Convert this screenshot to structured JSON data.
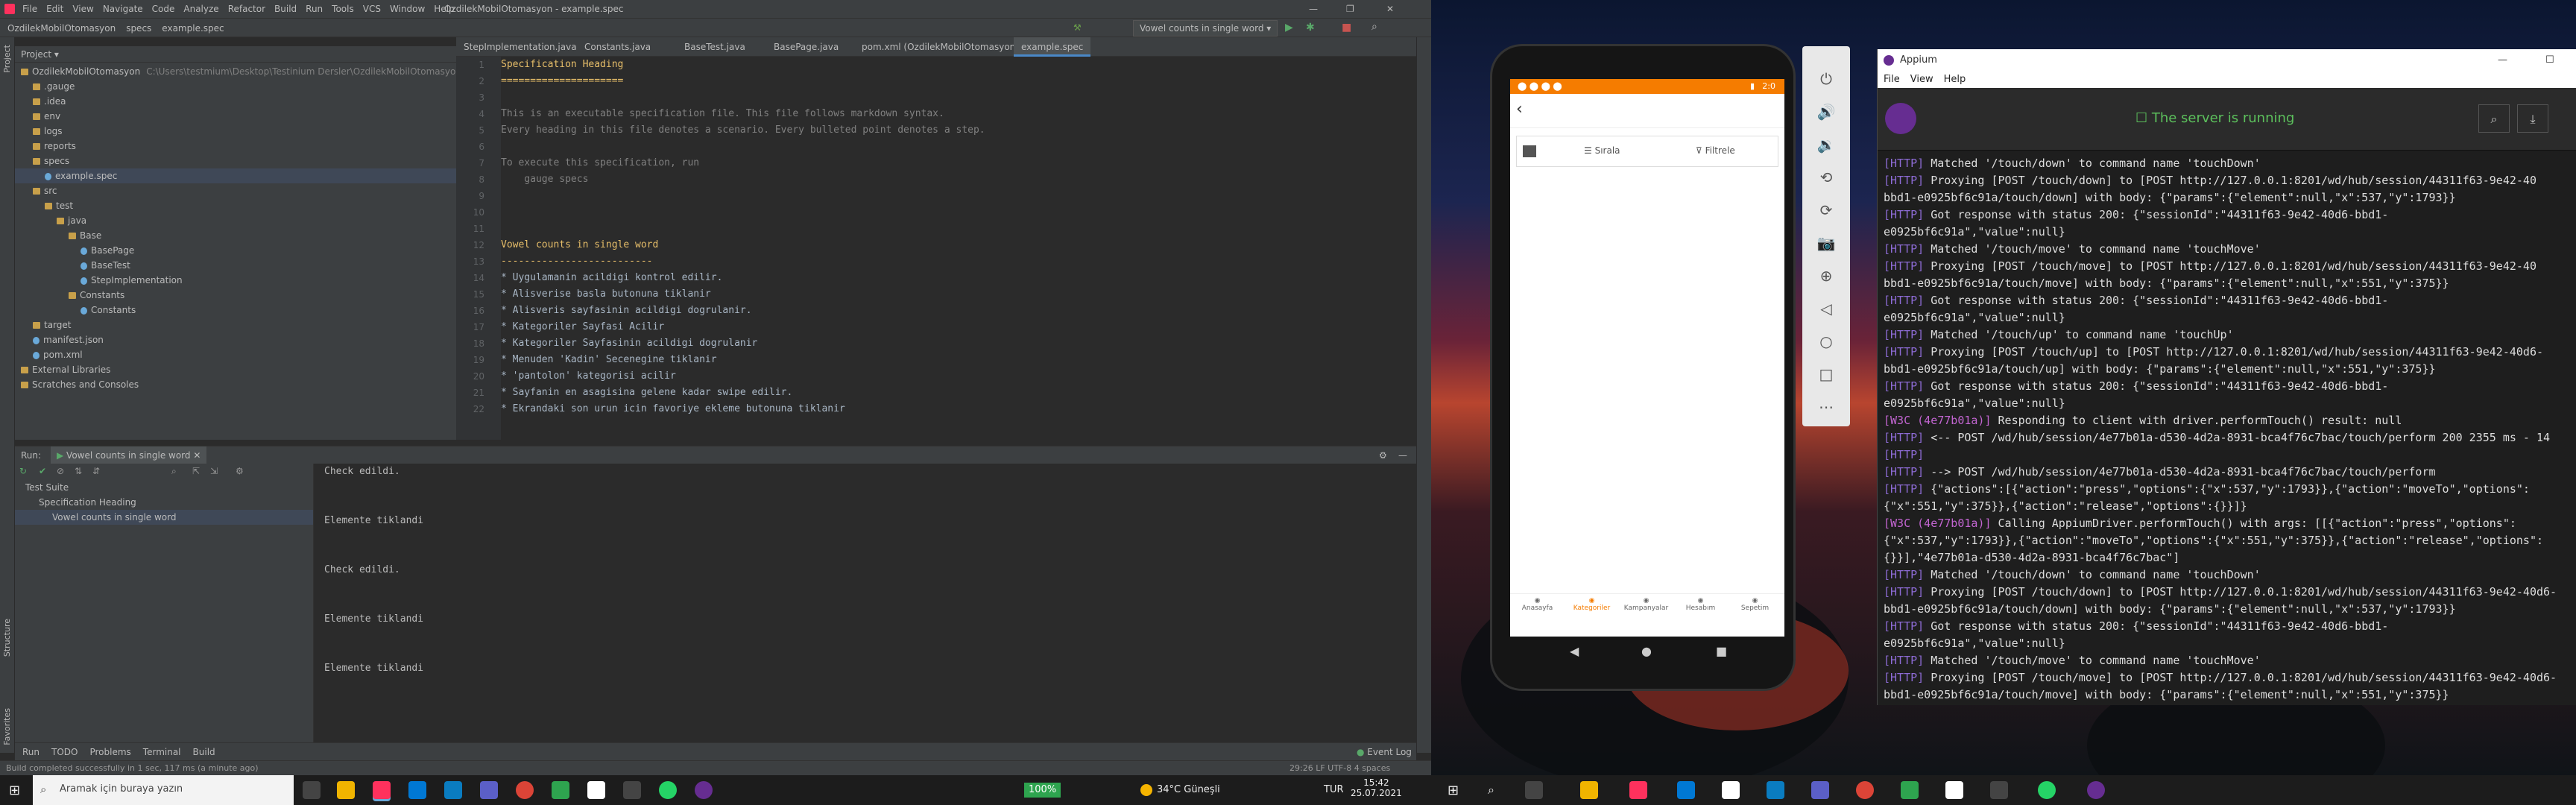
{
  "ide": {
    "title": "OzdilekMobilOtomasyon - example.spec",
    "menu": [
      "File",
      "Edit",
      "View",
      "Navigate",
      "Code",
      "Analyze",
      "Refactor",
      "Build",
      "Run",
      "Tools",
      "VCS",
      "Window",
      "Help"
    ],
    "breadcrumb": [
      "OzdilekMobilOtomasyon",
      "specs",
      "example.spec"
    ],
    "run_config": "Vowel counts in single word",
    "project_panel_label": "Project",
    "project_tree": [
      {
        "label": "OzdilekMobilOtomasyon",
        "path": "C:\\Users\\testmium\\Desktop\\Testinium Dersler\\OzdilekMobilOtomasyon\\Oz",
        "indent": 0,
        "type": "folder"
      },
      {
        "label": ".gauge",
        "indent": 1,
        "type": "folder"
      },
      {
        "label": ".idea",
        "indent": 1,
        "type": "folder"
      },
      {
        "label": "env",
        "indent": 1,
        "type": "folder"
      },
      {
        "label": "logs",
        "indent": 1,
        "type": "folder"
      },
      {
        "label": "reports",
        "indent": 1,
        "type": "folder"
      },
      {
        "label": "specs",
        "indent": 1,
        "type": "folder"
      },
      {
        "label": "example.spec",
        "indent": 2,
        "type": "file",
        "selected": true
      },
      {
        "label": "src",
        "indent": 1,
        "type": "folder"
      },
      {
        "label": "test",
        "indent": 2,
        "type": "folder"
      },
      {
        "label": "java",
        "indent": 3,
        "type": "folder"
      },
      {
        "label": "Base",
        "indent": 4,
        "type": "folder"
      },
      {
        "label": "BasePage",
        "indent": 5,
        "type": "file"
      },
      {
        "label": "BaseTest",
        "indent": 5,
        "type": "file"
      },
      {
        "label": "StepImplementation",
        "indent": 5,
        "type": "file"
      },
      {
        "label": "Constants",
        "indent": 4,
        "type": "folder"
      },
      {
        "label": "Constants",
        "indent": 5,
        "type": "file"
      },
      {
        "label": "target",
        "indent": 1,
        "type": "folder"
      },
      {
        "label": "manifest.json",
        "indent": 1,
        "type": "file"
      },
      {
        "label": "pom.xml",
        "indent": 1,
        "type": "file"
      },
      {
        "label": "External Libraries",
        "indent": 0,
        "type": "folder"
      },
      {
        "label": "Scratches and Consoles",
        "indent": 0,
        "type": "folder"
      }
    ],
    "tabs": [
      "StepImplementation.java",
      "Constants.java",
      "BaseTest.java",
      "BasePage.java",
      "pom.xml (OzdilekMobilOtomasyon)",
      "example.spec"
    ],
    "active_tab": 5,
    "editor_lines": [
      {
        "n": "1",
        "text": "Specification Heading",
        "kind": "head"
      },
      {
        "n": "2",
        "text": "=====================",
        "kind": "head"
      },
      {
        "n": "3",
        "text": "",
        "kind": "note"
      },
      {
        "n": "4",
        "text": "This is an executable specification file. This file follows markdown syntax.",
        "kind": "note"
      },
      {
        "n": "5",
        "text": "Every heading in this file denotes a scenario. Every bulleted point denotes a step.",
        "kind": "note"
      },
      {
        "n": "6",
        "text": "",
        "kind": "note"
      },
      {
        "n": "7",
        "text": "To execute this specification, run",
        "kind": "note"
      },
      {
        "n": "8",
        "text": "    gauge specs",
        "kind": "note"
      },
      {
        "n": "9",
        "text": "",
        "kind": "note"
      },
      {
        "n": "10",
        "text": "",
        "kind": "note"
      },
      {
        "n": "11",
        "text": "",
        "kind": "note"
      },
      {
        "n": "12",
        "text": "Vowel counts in single word",
        "kind": "head"
      },
      {
        "n": "13",
        "text": "--------------------------",
        "kind": "head"
      },
      {
        "n": "14",
        "text": "* Uygulamanin acildigi kontrol edilir.",
        "kind": "step"
      },
      {
        "n": "15",
        "text": "* Alisverise basla butonuna tiklanir",
        "kind": "step"
      },
      {
        "n": "16",
        "text": "* Alisveris sayfasinin acildigi dogrulanir.",
        "kind": "step"
      },
      {
        "n": "17",
        "text": "* Kategoriler Sayfasi Acilir",
        "kind": "step"
      },
      {
        "n": "18",
        "text": "* Kategoriler Sayfasinin acildigi dogrulanir",
        "kind": "step"
      },
      {
        "n": "19",
        "text": "* Menuden 'Kadin' Secenegine tiklanir",
        "kind": "step"
      },
      {
        "n": "20",
        "text": "* 'pantolon' kategorisi acilir",
        "kind": "step"
      },
      {
        "n": "21",
        "text": "* Sayfanin en asagisina gelene kadar swipe edilir.",
        "kind": "step"
      },
      {
        "n": "22",
        "text": "* Ekrandaki son urun icin favoriye ekleme butonuna tiklanir",
        "kind": "step"
      }
    ],
    "run_tab_label": "Run:",
    "run_tab_config": "Vowel counts in single word",
    "test_tree": [
      {
        "label": "Test Suite",
        "indent": 0
      },
      {
        "label": "Specification Heading",
        "indent": 1
      },
      {
        "label": "Vowel counts in single word",
        "indent": 2,
        "selected": true
      }
    ],
    "console_lines": [
      "Check edildi.",
      "Elemente tiklandi",
      "Check edildi.",
      "Elemente tiklandi",
      "Elemente tiklandi"
    ],
    "bottom_tabs": [
      "Run",
      "TODO",
      "Problems",
      "Terminal",
      "Build"
    ],
    "event_log": "Event Log",
    "status_left": "Build completed successfully in 1 sec, 117 ms (a minute ago)",
    "status_right": "29:26   LF   UTF-8   4 spaces",
    "sidebar_left": [
      "Project",
      "Structure",
      "Favorites"
    ]
  },
  "phone": {
    "status_time": "2:0",
    "tabs": [
      "Sırala",
      "Filtrele"
    ],
    "bottom_nav": [
      "Anasayfa",
      "Kategoriler",
      "Kampanyalar",
      "Hesabım",
      "Sepetim"
    ],
    "active_nav": 1,
    "accent": "#f57c00"
  },
  "emulator_tools": [
    "power-icon",
    "volume-up-icon",
    "volume-down-icon",
    "rotate-left-icon",
    "rotate-right-icon",
    "camera-icon",
    "zoom-icon",
    "back-icon",
    "home-icon",
    "overview-icon",
    "more-icon"
  ],
  "appium": {
    "title": "Appium",
    "menu": [
      "File",
      "View",
      "Help"
    ],
    "status": "The server is running",
    "log": [
      {
        "tag": "[HTTP]",
        "text": "Matched '/touch/down' to command name 'touchDown'",
        "hl": false
      },
      {
        "tag": "[HTTP]",
        "text": "Proxying [POST /touch/down] to [POST http://127.0.0.1:8201/wd/hub/session/44311f63-9e42-40",
        "hl": false
      },
      {
        "tag": "",
        "text": "bbd1-e0925bf6c91a/touch/down] with body: {\"params\":{\"element\":null,\"x\":537,\"y\":1793}}",
        "hl": false
      },
      {
        "tag": "[HTTP]",
        "text": "Got response with status 200: {\"sessionId\":\"44311f63-9e42-40d6-bbd1-",
        "hl": false
      },
      {
        "tag": "",
        "text": "e0925bf6c91a\",\"value\":null}",
        "hl": false
      },
      {
        "tag": "[HTTP]",
        "text": "Matched '/touch/move' to command name 'touchMove'",
        "hl": false
      },
      {
        "tag": "[HTTP]",
        "text": "Proxying [POST /touch/move] to [POST http://127.0.0.1:8201/wd/hub/session/44311f63-9e42-40",
        "hl": false
      },
      {
        "tag": "",
        "text": "bbd1-e0925bf6c91a/touch/move] with body: {\"params\":{\"element\":null,\"x\":551,\"y\":375}}",
        "hl": false
      },
      {
        "tag": "[HTTP]",
        "text": "Got response with status 200: {\"sessionId\":\"44311f63-9e42-40d6-bbd1-",
        "hl": false
      },
      {
        "tag": "",
        "text": "e0925bf6c91a\",\"value\":null}",
        "hl": false
      },
      {
        "tag": "[HTTP]",
        "text": "Matched '/touch/up' to command name 'touchUp'",
        "hl": false
      },
      {
        "tag": "[HTTP]",
        "text": "Proxying [POST /touch/up] to [POST http://127.0.0.1:8201/wd/hub/session/44311f63-9e42-40d6-",
        "hl": false
      },
      {
        "tag": "",
        "text": "bbd1-e0925bf6c91a/touch/up] with body: {\"params\":{\"element\":null,\"x\":551,\"y\":375}}",
        "hl": false
      },
      {
        "tag": "[HTTP]",
        "text": "Got response with status 200: {\"sessionId\":\"44311f63-9e42-40d6-bbd1-",
        "hl": false
      },
      {
        "tag": "",
        "text": "e0925bf6c91a\",\"value\":null}",
        "hl": false
      },
      {
        "tag": "[W3C (4e77b01a)]",
        "text": "Responding to client with driver.performTouch() result: null",
        "hl": true
      },
      {
        "tag": "[HTTP]",
        "text": "<-- POST /wd/hub/session/4e77b01a-d530-4d2a-8931-bca4f76c7bac/touch/perform 200 2355 ms - 14",
        "hl": false
      },
      {
        "tag": "[HTTP]",
        "text": "",
        "hl": false
      },
      {
        "tag": "[HTTP]",
        "text": "--> POST /wd/hub/session/4e77b01a-d530-4d2a-8931-bca4f76c7bac/touch/perform",
        "hl": false
      },
      {
        "tag": "[HTTP]",
        "text": "{\"actions\":[{\"action\":\"press\",\"options\":{\"x\":537,\"y\":1793}},{\"action\":\"moveTo\",\"options\":",
        "hl": false
      },
      {
        "tag": "",
        "text": "{\"x\":551,\"y\":375}},{\"action\":\"release\",\"options\":{}}]}",
        "hl": false
      },
      {
        "tag": "[W3C (4e77b01a)]",
        "text": "Calling AppiumDriver.performTouch() with args: [[{\"action\":\"press\",\"options\":",
        "hl": true
      },
      {
        "tag": "",
        "text": "{\"x\":537,\"y\":1793}},{\"action\":\"moveTo\",\"options\":{\"x\":551,\"y\":375}},{\"action\":\"release\",\"options\":",
        "hl": false
      },
      {
        "tag": "",
        "text": "{}}],\"4e77b01a-d530-4d2a-8931-bca4f76c7bac\"]",
        "hl": false
      },
      {
        "tag": "[HTTP]",
        "text": "Matched '/touch/down' to command name 'touchDown'",
        "hl": false
      },
      {
        "tag": "[HTTP]",
        "text": "Proxying [POST /touch/down] to [POST http://127.0.0.1:8201/wd/hub/session/44311f63-9e42-40d6-",
        "hl": false
      },
      {
        "tag": "",
        "text": "bbd1-e0925bf6c91a/touch/down] with body: {\"params\":{\"element\":null,\"x\":537,\"y\":1793}}",
        "hl": false
      },
      {
        "tag": "[HTTP]",
        "text": "Got response with status 200: {\"sessionId\":\"44311f63-9e42-40d6-bbd1-",
        "hl": false
      },
      {
        "tag": "",
        "text": "e0925bf6c91a\",\"value\":null}",
        "hl": false
      },
      {
        "tag": "[HTTP]",
        "text": "Matched '/touch/move' to command name 'touchMove'",
        "hl": false
      },
      {
        "tag": "[HTTP]",
        "text": "Proxying [POST /touch/move] to [POST http://127.0.0.1:8201/wd/hub/session/44311f63-9e42-40d6-",
        "hl": false
      },
      {
        "tag": "",
        "text": "bbd1-e0925bf6c91a/touch/move] with body: {\"params\":{\"element\":null,\"x\":551,\"y\":375}}",
        "hl": false
      }
    ]
  },
  "taskbar": {
    "search_placeholder": "Aramak için buraya yazın",
    "battery": "100%",
    "weather": "34°C  Güneşli",
    "lang": "TUR",
    "time": "15:42",
    "date": "25.07.2021"
  }
}
